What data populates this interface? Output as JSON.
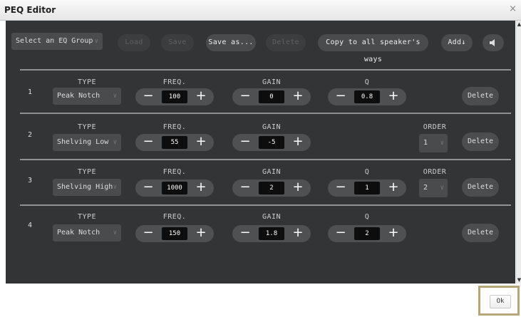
{
  "window": {
    "title": "PEQ Editor",
    "close_glyph": "×"
  },
  "toolbar": {
    "group_select": "Select an EQ Group",
    "load": "Load",
    "save": "Save",
    "save_as": "Save as...",
    "delete": "Delete",
    "copy_all": "Copy to all speaker's ways",
    "add": "Add↓",
    "speaker_icon": "speaker-icon"
  },
  "labels": {
    "type": "TYPE",
    "freq": "FREQ.",
    "gain": "GAIN",
    "q": "Q",
    "order": "ORDER",
    "delete": "Delete"
  },
  "stepper": {
    "minus": "−",
    "plus": "+"
  },
  "chevron": "∨",
  "filters": [
    {
      "num": "1",
      "type": "Peak Notch",
      "freq": "100",
      "gain": "0",
      "q": "0.8"
    },
    {
      "num": "2",
      "type": "Shelving Low",
      "freq": "55",
      "gain": "-5",
      "order": "1"
    },
    {
      "num": "3",
      "type": "Shelving High",
      "freq": "1000",
      "gain": "2",
      "q": "1",
      "order": "2"
    },
    {
      "num": "4",
      "type": "Peak Notch",
      "freq": "150",
      "gain": "1.8",
      "q": "2"
    }
  ],
  "footer": {
    "ok": "Ok"
  }
}
